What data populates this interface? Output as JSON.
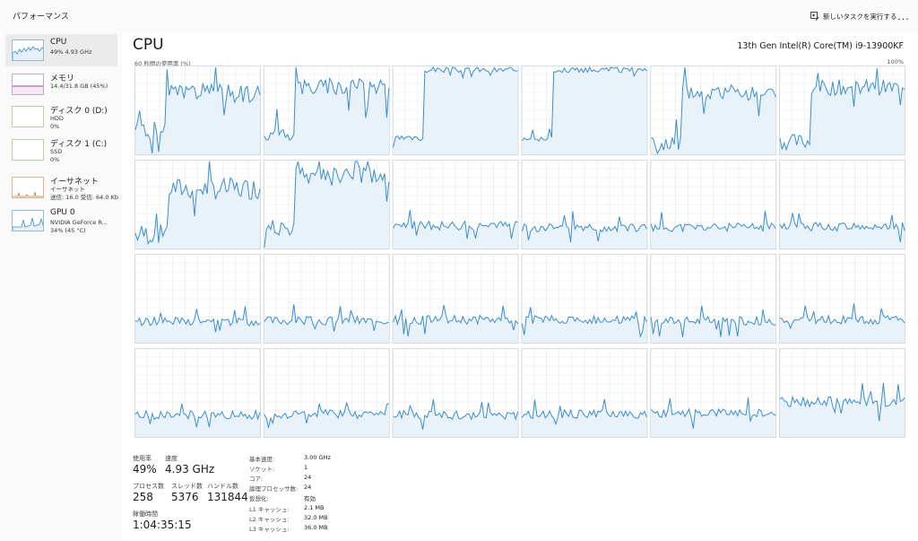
{
  "window": {
    "title": "パフォーマンス"
  },
  "toolbar": {
    "new_task_label": "新しいタスクを実行する",
    "more_label": "..."
  },
  "sidebar": {
    "items": [
      {
        "name": "CPU",
        "line1": "49%  4.93 GHz",
        "line2": ""
      },
      {
        "name": "メモリ",
        "line1": "14.4/31.8 GB (45%)",
        "line2": ""
      },
      {
        "name": "ディスク 0 (D:)",
        "line1": "HDD",
        "line2": "0%"
      },
      {
        "name": "ディスク 1 (C:)",
        "line1": "SSD",
        "line2": "0%"
      },
      {
        "name": "イーサネット",
        "line1": "イーサネット",
        "line2": "送信: 16.0  受信: 64.0 Kb"
      },
      {
        "name": "GPU 0",
        "line1": "NVIDIA GeForce R...",
        "line2": "34%  (45 °C)"
      }
    ]
  },
  "main": {
    "title": "CPU",
    "model": "13th Gen Intel(R) Core(TM) i9-13900KF",
    "util_label": "60 秒間の使用率 (%)",
    "util_max": "100%"
  },
  "stats": {
    "usage_label": "使用率",
    "usage_value": "49%",
    "speed_label": "速度",
    "speed_value": "4.93 GHz",
    "processes_label": "プロセス数",
    "processes_value": "258",
    "threads_label": "スレッド数",
    "threads_value": "5376",
    "handles_label": "ハンドル数",
    "handles_value": "131844",
    "uptime_label": "稼働時間",
    "uptime_value": "1:04:35:15"
  },
  "specs": [
    {
      "key": "基本速度:",
      "value": "3.00 GHz"
    },
    {
      "key": "ソケット:",
      "value": "1"
    },
    {
      "key": "コア:",
      "value": "24"
    },
    {
      "key": "論理プロセッサ数:",
      "value": "24"
    },
    {
      "key": "仮想化:",
      "value": "有効"
    },
    {
      "key": "L1 キャッシュ:",
      "value": "2.1 MB"
    },
    {
      "key": "L2 キャッシュ:",
      "value": "32.0 MB"
    },
    {
      "key": "L3 キャッシュ:",
      "value": "36.0 MB"
    }
  ],
  "colors": {
    "line": "#3a8ed0",
    "fill": "#e9f2f9",
    "grid": "#e3e9ee",
    "border": "#d2d9df",
    "memory": "#a24aa4",
    "ethernet": "#c27a3a"
  },
  "chart_data": {
    "type": "line",
    "title": "",
    "xlabel": "",
    "ylabel": "60 秒間の使用率 (%)",
    "ylim": [
      0,
      100
    ],
    "points_per_core": 60,
    "cores": [
      {
        "core": 1,
        "base": 70,
        "start": 27,
        "noise": 22
      },
      {
        "core": 2,
        "base": 78,
        "start": 23,
        "noise": 20
      },
      {
        "core": 3,
        "base": 96,
        "start": 18,
        "noise": 6
      },
      {
        "core": 4,
        "base": 96,
        "start": 18,
        "noise": 6
      },
      {
        "core": 5,
        "base": 70,
        "start": 12,
        "noise": 18
      },
      {
        "core": 6,
        "base": 76,
        "start": 14,
        "noise": 18
      },
      {
        "core": 7,
        "base": 68,
        "start": 16,
        "noise": 25
      },
      {
        "core": 8,
        "base": 82,
        "start": 24,
        "noise": 22
      },
      {
        "core": 9,
        "base": 26,
        "start": 0,
        "noise": 10
      },
      {
        "core": 10,
        "base": 24,
        "start": 0,
        "noise": 10
      },
      {
        "core": 11,
        "base": 24,
        "start": 0,
        "noise": 10
      },
      {
        "core": 12,
        "base": 25,
        "start": 0,
        "noise": 10
      },
      {
        "core": 13,
        "base": 24,
        "start": 0,
        "noise": 10
      },
      {
        "core": 14,
        "base": 25,
        "start": 0,
        "noise": 10
      },
      {
        "core": 15,
        "base": 26,
        "start": 0,
        "noise": 10
      },
      {
        "core": 16,
        "base": 26,
        "start": 0,
        "noise": 10
      },
      {
        "core": 17,
        "base": 25,
        "start": 0,
        "noise": 10
      },
      {
        "core": 18,
        "base": 26,
        "start": 0,
        "noise": 10
      },
      {
        "core": 19,
        "base": 25,
        "start": 0,
        "noise": 10
      },
      {
        "core": 20,
        "base": 26,
        "start": 0,
        "noise": 10
      },
      {
        "core": 21,
        "base": 25,
        "start": 0,
        "noise": 10
      },
      {
        "core": 22,
        "base": 26,
        "start": 0,
        "noise": 10
      },
      {
        "core": 23,
        "base": 27,
        "start": 0,
        "noise": 10
      },
      {
        "core": 24,
        "base": 40,
        "start": 0,
        "noise": 12
      }
    ]
  }
}
